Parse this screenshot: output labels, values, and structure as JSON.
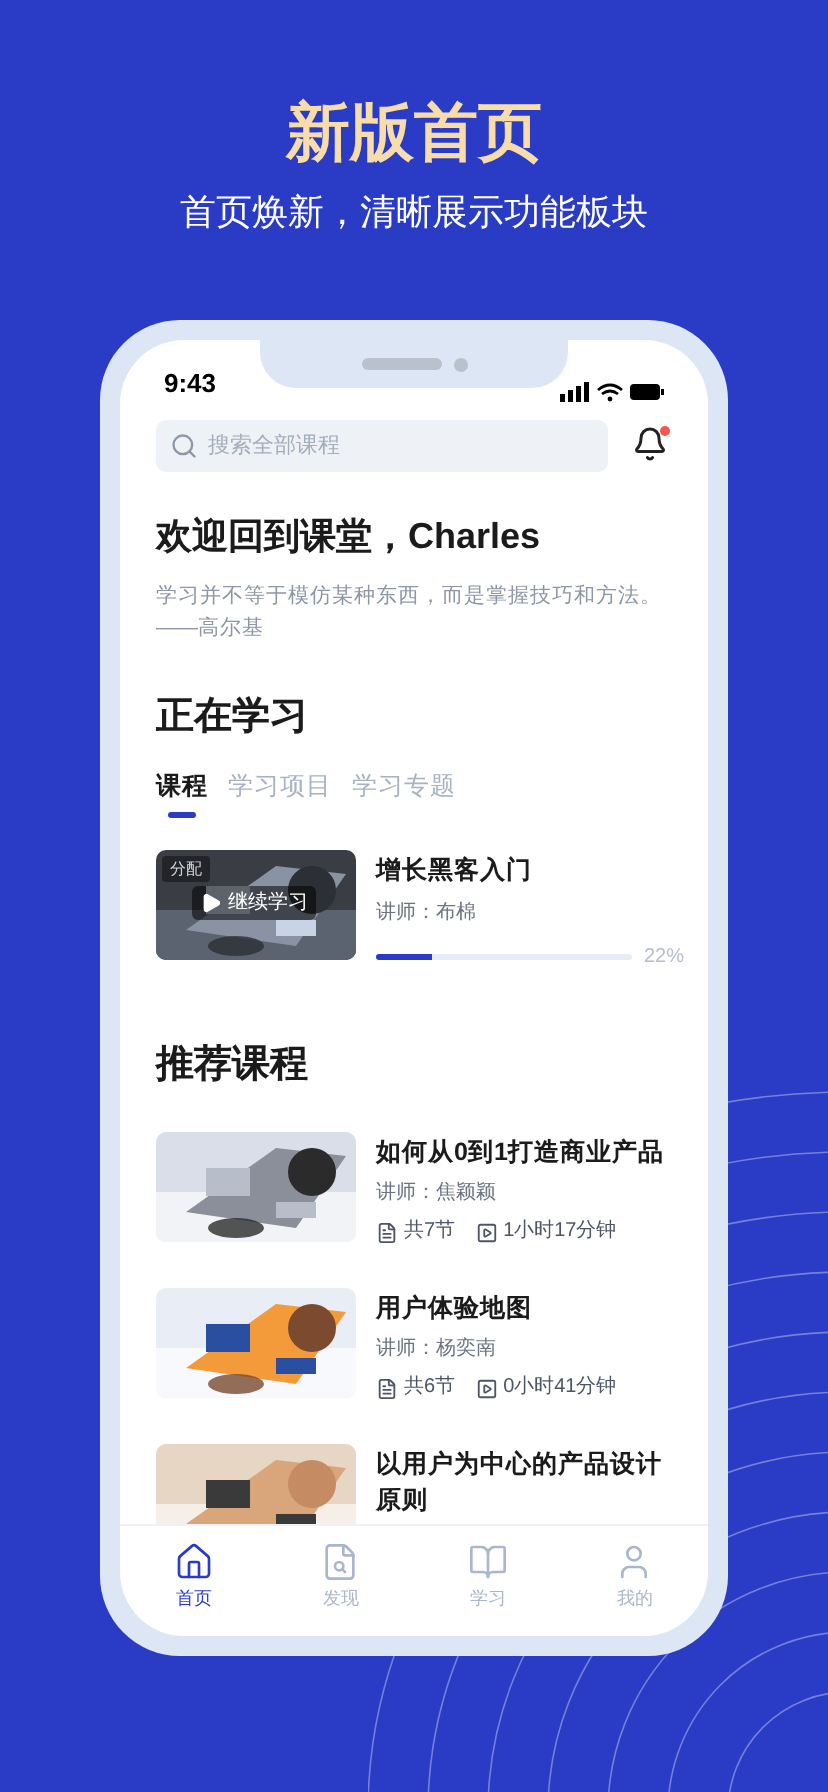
{
  "header": {
    "title": "新版首页",
    "subtitle": "首页焕新，清晰展示功能板块"
  },
  "status_bar": {
    "time": "9:43"
  },
  "search": {
    "placeholder": "搜索全部课程"
  },
  "notifications": {
    "unread": true
  },
  "welcome": {
    "title": "欢迎回到课堂，Charles",
    "quote": "学习并不等于模仿某种东西，而是掌握技巧和方法。",
    "author": "——高尔基"
  },
  "learning": {
    "title": "正在学习",
    "tabs": [
      {
        "label": "课程",
        "selected": true
      },
      {
        "label": "学习项目",
        "selected": false
      },
      {
        "label": "学习专题",
        "selected": false
      }
    ],
    "course": {
      "tag": "分配",
      "action": "继续学习",
      "title": "增长黑客入门",
      "instructor": "讲师：布棉",
      "level": 0.22,
      "progress": "22%"
    }
  },
  "recommended": {
    "title": "推荐课程",
    "courses": [
      {
        "title": "如何从0到1打造商业产品",
        "instructor": "讲师：焦颖颖",
        "lessons": "共7节",
        "duration": "1小时17分钟"
      },
      {
        "title": "用户体验地图",
        "instructor": "讲师：杨奕南",
        "lessons": "共6节",
        "duration": "0小时41分钟"
      },
      {
        "title": "以用户为中心的产品设计原则"
      }
    ]
  },
  "tab_bar": [
    {
      "label": "首页",
      "selected": true
    },
    {
      "label": "发现",
      "selected": false
    },
    {
      "label": "学习",
      "selected": false
    },
    {
      "label": "我的",
      "selected": false
    }
  ]
}
